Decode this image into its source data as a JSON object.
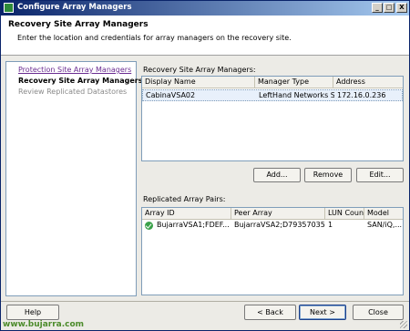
{
  "window": {
    "title": "Configure Array Managers",
    "minimize": "_",
    "maximize": "□",
    "close": "X"
  },
  "header": {
    "title": "Recovery Site Array Managers",
    "subtitle": "Enter the location and credentials for array managers on the recovery site."
  },
  "steps": [
    {
      "label": "Protection Site Array Managers",
      "state": "visited"
    },
    {
      "label": "Recovery Site Array Managers",
      "state": "current"
    },
    {
      "label": "Review Replicated Datastores",
      "state": "pending"
    }
  ],
  "managers": {
    "label": "Recovery Site Array Managers:",
    "columns": [
      "Display Name",
      "Manager Type",
      "Address"
    ],
    "rows": [
      {
        "display_name": "CabinaVSA02",
        "manager_type": "LeftHand Networks S...",
        "address": "172.16.0.236"
      }
    ],
    "buttons": {
      "add": "Add...",
      "remove": "Remove",
      "edit": "Edit..."
    }
  },
  "pairs": {
    "label": "Replicated Array Pairs:",
    "columns": [
      "Array ID",
      "Peer Array",
      "LUN Count",
      "Model"
    ],
    "rows": [
      {
        "array_id": "BujarraVSA1;FDEF...",
        "peer_array": "BujarraVSA2;D79357035...",
        "lun_count": "1",
        "model": "SAN/iQ,...",
        "status_icon": "check-circle"
      }
    ]
  },
  "footer": {
    "help": "Help",
    "back": "< Back",
    "next": "Next >",
    "close": "Close"
  },
  "watermark": "www.bujarra.com",
  "colors": {
    "titlebar": "#0a246a",
    "visited_link": "#6a2c91",
    "ok": "#3aa14a",
    "watermark": "#4c8b2b"
  }
}
